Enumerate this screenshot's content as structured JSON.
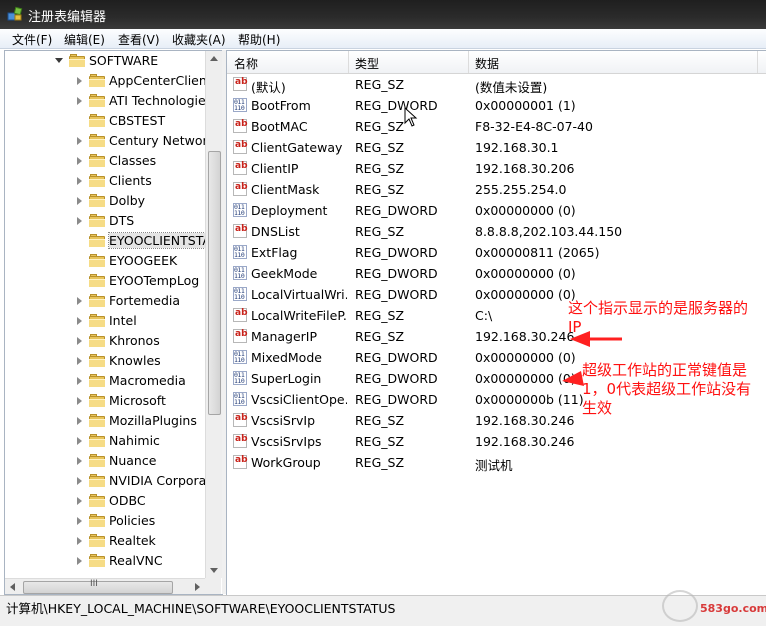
{
  "window": {
    "title": "注册表编辑器"
  },
  "menu": [
    "文件(F)",
    "编辑(E)",
    "查看(V)",
    "收藏夹(A)",
    "帮助(H)"
  ],
  "tree": {
    "root": "SOFTWARE",
    "items": [
      {
        "label": "AppCenterClient",
        "expandable": true
      },
      {
        "label": "ATI Technologie",
        "expandable": true
      },
      {
        "label": "CBSTEST",
        "expandable": false
      },
      {
        "label": "Century Network",
        "expandable": true
      },
      {
        "label": "Classes",
        "expandable": true
      },
      {
        "label": "Clients",
        "expandable": true
      },
      {
        "label": "Dolby",
        "expandable": true
      },
      {
        "label": "DTS",
        "expandable": true
      },
      {
        "label": "EYOOCLIENTSTA",
        "expandable": false,
        "selected": true
      },
      {
        "label": "EYOOGEEK",
        "expandable": false
      },
      {
        "label": "EYOOTempLog",
        "expandable": false
      },
      {
        "label": "Fortemedia",
        "expandable": true
      },
      {
        "label": "Intel",
        "expandable": true
      },
      {
        "label": "Khronos",
        "expandable": true
      },
      {
        "label": "Knowles",
        "expandable": true
      },
      {
        "label": "Macromedia",
        "expandable": true
      },
      {
        "label": "Microsoft",
        "expandable": true
      },
      {
        "label": "MozillaPlugins",
        "expandable": true
      },
      {
        "label": "Nahimic",
        "expandable": true
      },
      {
        "label": "Nuance",
        "expandable": true
      },
      {
        "label": "NVIDIA Corpora",
        "expandable": true
      },
      {
        "label": "ODBC",
        "expandable": true
      },
      {
        "label": "Policies",
        "expandable": true
      },
      {
        "label": "Realtek",
        "expandable": true
      },
      {
        "label": "RealVNC",
        "expandable": true
      }
    ],
    "hscroll_grip": "III"
  },
  "list": {
    "columns": {
      "name": "名称",
      "type": "类型",
      "data": "数据"
    },
    "rows": [
      {
        "name": "(默认)",
        "type": "REG_SZ",
        "data": "(数值未设置)",
        "kind": "sz"
      },
      {
        "name": "BootFrom",
        "type": "REG_DWORD",
        "data": "0x00000001 (1)",
        "kind": "dw"
      },
      {
        "name": "BootMAC",
        "type": "REG_SZ",
        "data": "F8-32-E4-8C-07-40",
        "kind": "sz"
      },
      {
        "name": "ClientGateway",
        "type": "REG_SZ",
        "data": "192.168.30.1",
        "kind": "sz"
      },
      {
        "name": "ClientIP",
        "type": "REG_SZ",
        "data": "192.168.30.206",
        "kind": "sz"
      },
      {
        "name": "ClientMask",
        "type": "REG_SZ",
        "data": "255.255.254.0",
        "kind": "sz"
      },
      {
        "name": "Deployment",
        "type": "REG_DWORD",
        "data": "0x00000000 (0)",
        "kind": "dw"
      },
      {
        "name": "DNSList",
        "type": "REG_SZ",
        "data": "8.8.8.8,202.103.44.150",
        "kind": "sz"
      },
      {
        "name": "ExtFlag",
        "type": "REG_DWORD",
        "data": "0x00000811 (2065)",
        "kind": "dw"
      },
      {
        "name": "GeekMode",
        "type": "REG_DWORD",
        "data": "0x00000000 (0)",
        "kind": "dw"
      },
      {
        "name": "LocalVirtualWri...",
        "type": "REG_DWORD",
        "data": "0x00000000 (0)",
        "kind": "dw"
      },
      {
        "name": "LocalWriteFileP...",
        "type": "REG_SZ",
        "data": "C:\\",
        "kind": "sz"
      },
      {
        "name": "ManagerIP",
        "type": "REG_SZ",
        "data": "192.168.30.246",
        "kind": "sz"
      },
      {
        "name": "MixedMode",
        "type": "REG_DWORD",
        "data": "0x00000000 (0)",
        "kind": "dw"
      },
      {
        "name": "SuperLogin",
        "type": "REG_DWORD",
        "data": "0x00000000 (0)",
        "kind": "dw"
      },
      {
        "name": "VscsiClientOpe...",
        "type": "REG_DWORD",
        "data": "0x0000000b (11)",
        "kind": "dw"
      },
      {
        "name": "VscsiSrvIp",
        "type": "REG_SZ",
        "data": "192.168.30.246",
        "kind": "sz"
      },
      {
        "name": "VscsiSrvIps",
        "type": "REG_SZ",
        "data": "192.168.30.246",
        "kind": "sz"
      },
      {
        "name": "WorkGroup",
        "type": "REG_SZ",
        "data": "测试机",
        "kind": "sz"
      }
    ]
  },
  "icons": {
    "string_value": "ab",
    "dword_value": "011 110"
  },
  "annotations": {
    "manager": [
      "这个指示显示的是服务器的",
      "IP"
    ],
    "superlogin": [
      "超级工作站的正常键值是",
      "1，0代表超级工作站没有",
      "生效"
    ]
  },
  "status": {
    "path": "计算机\\HKEY_LOCAL_MACHINE\\SOFTWARE\\EYOOCLIENTSTATUS"
  },
  "watermark": "583go.com",
  "colors": {
    "annotation": "#ff1010",
    "title_bar": "#2b2b2b",
    "string_icon": "#c8221a"
  }
}
